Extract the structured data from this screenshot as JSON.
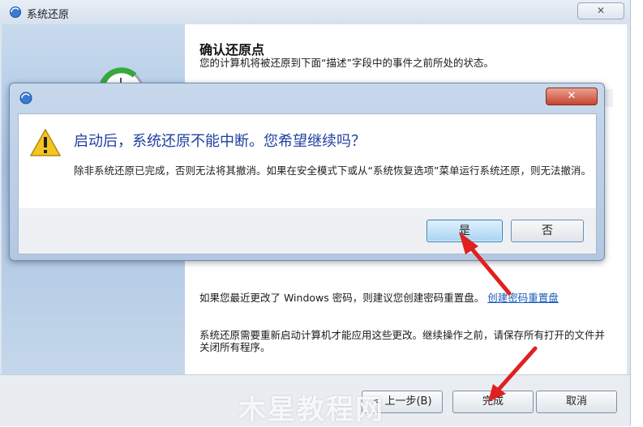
{
  "window": {
    "title": "系统还原",
    "close_label": "✕",
    "heading": "确认还原点",
    "description": "您的计算机将被还原到下面“描述”字段中的事件之前所处的状态。",
    "password_tip": "如果您最近更改了 Windows 密码，则建议您创建密码重置盘。",
    "password_link": "创建密码重置盘",
    "restart_tip": "系统还原需要重新启动计算机才能应用这些更改。继续操作之前，请保存所有打开的文件并关闭所有程序。",
    "buttons": {
      "back": "< 上一步(B)",
      "finish": "完成",
      "cancel": "取消"
    }
  },
  "dialog": {
    "close_label": "✕",
    "main_instruction": "启动后，系统还原不能中断。您希望继续吗？",
    "content": "除非系统还原已完成，否则无法将其撤消。如果在安全模式下或从“系统恢复选项”菜单运行系统还原，则无法撤消。",
    "buttons": {
      "yes": "是",
      "no": "否"
    }
  },
  "watermark": "木星教程网",
  "colors": {
    "accent": "#1f3f9e",
    "arrow": "#e02020",
    "close_red": "#c7452e"
  }
}
